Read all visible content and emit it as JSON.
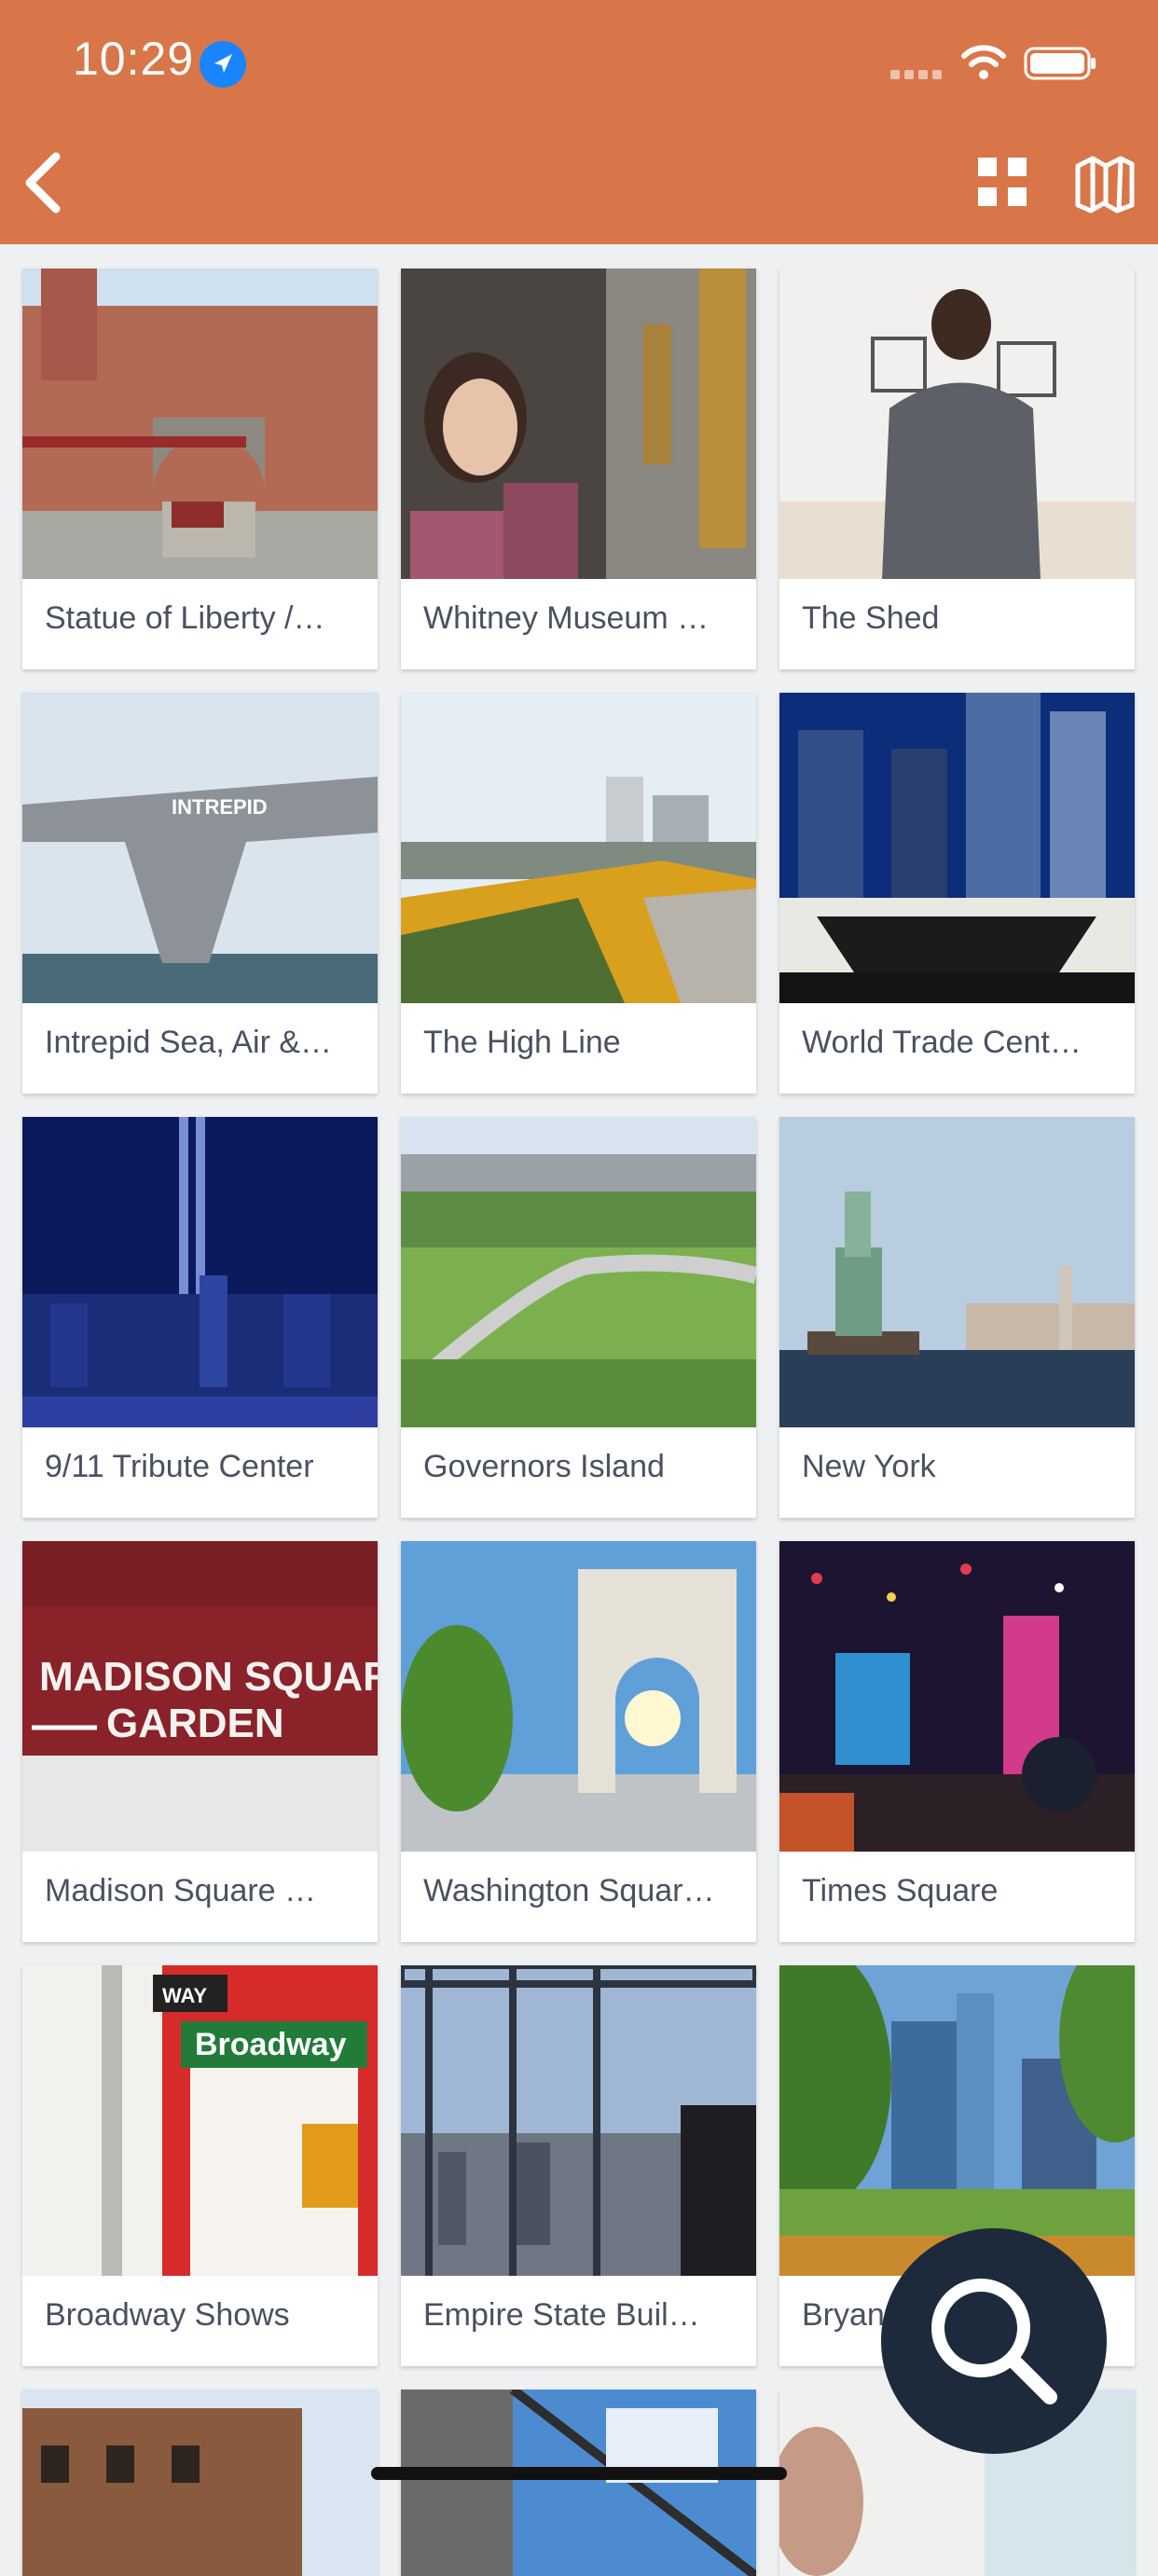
{
  "status_bar": {
    "time": "10:29"
  },
  "header": {
    "background": "#d8764a",
    "back_icon": "chevron-left-icon",
    "grid_icon": "grid-view-icon",
    "map_icon": "map-icon"
  },
  "tiles": [
    {
      "label": "Statue of Liberty /…",
      "image": "ellis-island-building"
    },
    {
      "label": "Whitney Museum …",
      "image": "woman-in-gallery"
    },
    {
      "label": "The Shed",
      "image": "man-viewing-art"
    },
    {
      "label": "Intrepid Sea, Air &…",
      "image": "aircraft-carrier"
    },
    {
      "label": "The High Line",
      "image": "elevated-park"
    },
    {
      "label": "World Trade Cent…",
      "image": "memorial-at-night"
    },
    {
      "label": "9/11 Tribute Center",
      "image": "tribute-in-light"
    },
    {
      "label": "Governors Island",
      "image": "green-island-park"
    },
    {
      "label": "New York",
      "image": "statue-of-liberty"
    },
    {
      "label": "Madison Square …",
      "image": "madison-square-garden-sign"
    },
    {
      "label": "Washington Squar…",
      "image": "washington-arch"
    },
    {
      "label": "Times Square",
      "image": "times-square-confetti"
    },
    {
      "label": "Broadway Shows",
      "image": "broadway-street-sign"
    },
    {
      "label": "Empire State Buil…",
      "image": "observation-deck"
    },
    {
      "label": "Bryan",
      "image": "bryant-park"
    },
    {
      "label": "",
      "image": "brick-building"
    },
    {
      "label": "",
      "image": "glass-tower"
    },
    {
      "label": "",
      "image": "portrait"
    }
  ],
  "tile_images": {
    "madison_sign_top": "MADISON SQUARE",
    "madison_sign_bottom": "GARDEN",
    "broadway_sign": "Broadway",
    "way_sign": "WAY",
    "intrepid_text": "INTREPID"
  },
  "fab": {
    "icon": "search-icon",
    "color": "#1c2a3c"
  }
}
